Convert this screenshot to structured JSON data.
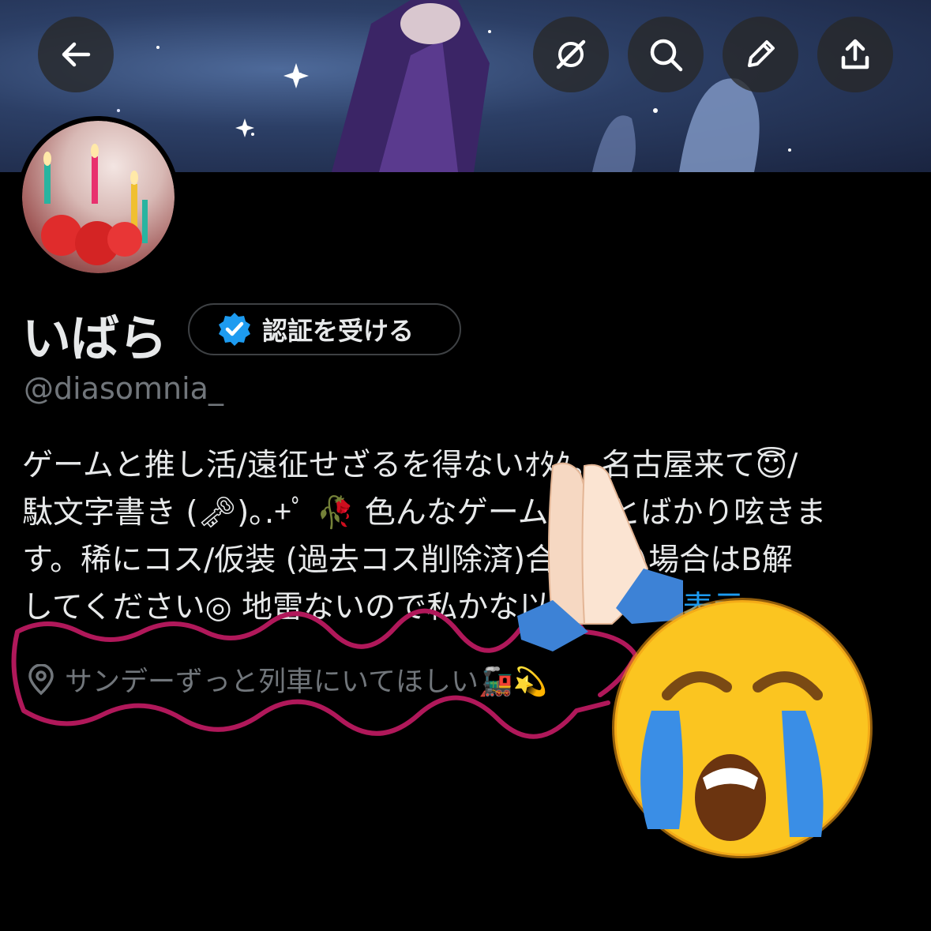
{
  "header": {
    "back_icon": "arrow-left-icon",
    "actions": [
      "grok-icon",
      "search-icon",
      "edit-icon",
      "share-icon"
    ]
  },
  "profile": {
    "display_name": "いばら",
    "verify_label": "認証を受ける",
    "handle": "@diasomnia_",
    "bio_lines": [
      "ゲームと推し活/遠征せざるを得ないｵﾀｸ。名古屋来て😇/",
      "駄文字書き (🗝)｡.+ﾟ 🥀 色んなゲームのことばかり呟きま",
      "す。稀にコス/仮装 (過去コス削除済)合わない場合はB解",
      "してください◎ 地雷ないので私かな以外"
    ],
    "show_more": "さらに表示",
    "location": "サンデーずっと列車にいてほしい🚂💫"
  },
  "stickers": [
    "folded-hands-emoji",
    "loudly-crying-face-emoji"
  ],
  "colors": {
    "accent": "#1d9bf0",
    "muted": "#71767b",
    "highlight_scribble": "#b0185a"
  }
}
